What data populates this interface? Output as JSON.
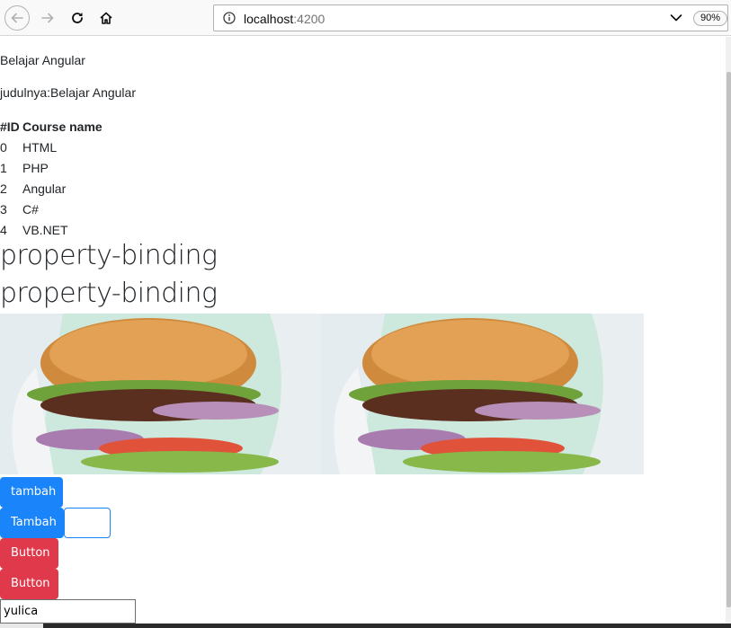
{
  "browser": {
    "url_host": "localhost",
    "url_port": ":4200",
    "zoom": "90%"
  },
  "page": {
    "title_line": "Belajar Angular",
    "subtitle_line": "judulnya:Belajar Angular",
    "table": {
      "headers": [
        "#ID",
        "Course name"
      ],
      "rows": [
        {
          "id": "0",
          "name": "HTML"
        },
        {
          "id": "1",
          "name": "PHP"
        },
        {
          "id": "2",
          "name": "Angular"
        },
        {
          "id": "3",
          "name": "C#"
        },
        {
          "id": "4",
          "name": "VB.NET"
        }
      ]
    },
    "headings": [
      "property-binding",
      "property-binding"
    ],
    "buttons": {
      "tambah_lower": "tambah",
      "tambah_upper": "Tambah",
      "button_1": "Button",
      "button_2": "Button"
    },
    "name_input_value": "yulica"
  },
  "colors": {
    "primary": "#1a84fb",
    "danger": "#e0394b"
  }
}
